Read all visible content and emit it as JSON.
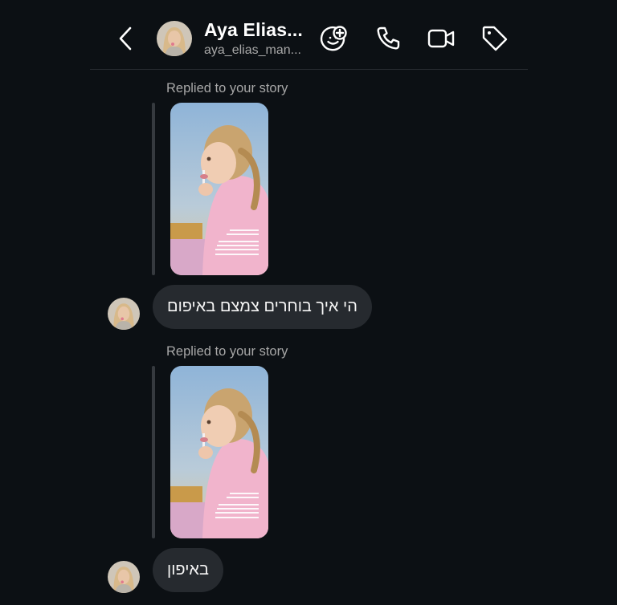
{
  "header": {
    "name": "Aya Elias...",
    "username": "aya_elias_man...",
    "icons": [
      "back-chevron-icon",
      "sticker-add-icon",
      "phone-icon",
      "video-camera-icon",
      "tag-icon"
    ]
  },
  "messages": [
    {
      "reply_label": "Replied to your story",
      "text": "הי איך בוחרים צמצם באיפום"
    },
    {
      "reply_label": "Replied to your story",
      "text": "באיפון"
    }
  ],
  "colors": {
    "background": "#0c1014",
    "bubble": "#262a2f",
    "secondary_text": "#a8a8a8"
  }
}
